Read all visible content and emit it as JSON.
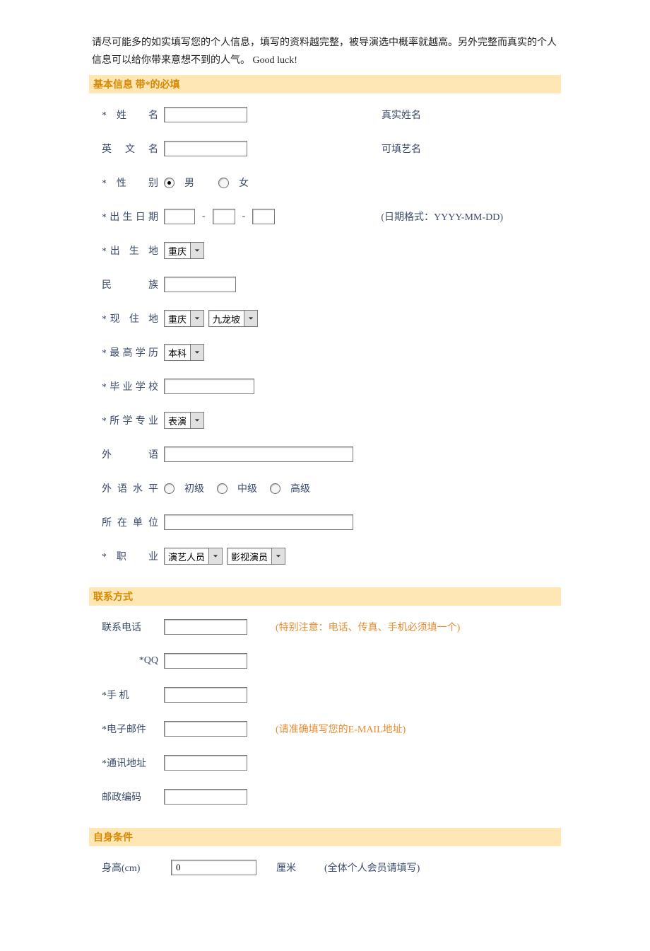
{
  "intro": "请尽可能多的如实填写您的个人信息，填写的资料越完整，被导演选中概率就越高。另外完整而真实的个人信息可以给你带来意想不到的人气。 Good luck!",
  "sections": {
    "basic": "基本信息   带*的必填",
    "contact": "联系方式",
    "physical": "自身条件"
  },
  "labels": {
    "name": "*姓   名",
    "ename": "英 文 名",
    "gender": "*性    别",
    "birth": "*出生日期",
    "birthplace": "*出 生 地",
    "ethnic": "民    族",
    "residence": "*现 住 地",
    "edu": "*最高学历",
    "school": "*毕业学校",
    "major": "*所学专业",
    "lang": "外    语",
    "langlevel": "外语水平",
    "company": "所在单位",
    "occupation": "*职    业",
    "phone": "联系电话",
    "qq": "*QQ",
    "mobile": "*手    机",
    "email": "*电子邮件",
    "address": "*通讯地址",
    "postcode": "邮政编码",
    "height": "身高(cm)"
  },
  "hints": {
    "name": "真实姓名",
    "ename": "可填艺名",
    "birth": "(日期格式：YYYY-MM-DD)",
    "phone": "(特别注意：电话、传真、手机必须填一个)",
    "email": "(请准确填写您的E-MAIL地址)",
    "height": "(全体个人会员请填写)"
  },
  "options": {
    "male": "男",
    "female": "女",
    "birthplace": "重庆",
    "residence1": "重庆",
    "residence2": "九龙坡",
    "edu": "本科",
    "major": "表演",
    "occ1": "演艺人员",
    "occ2": "影视演员",
    "lv1": "初级",
    "lv2": "中级",
    "lv3": "高级",
    "height_unit": "厘米"
  },
  "values": {
    "height": "0",
    "date_sep": "-"
  }
}
